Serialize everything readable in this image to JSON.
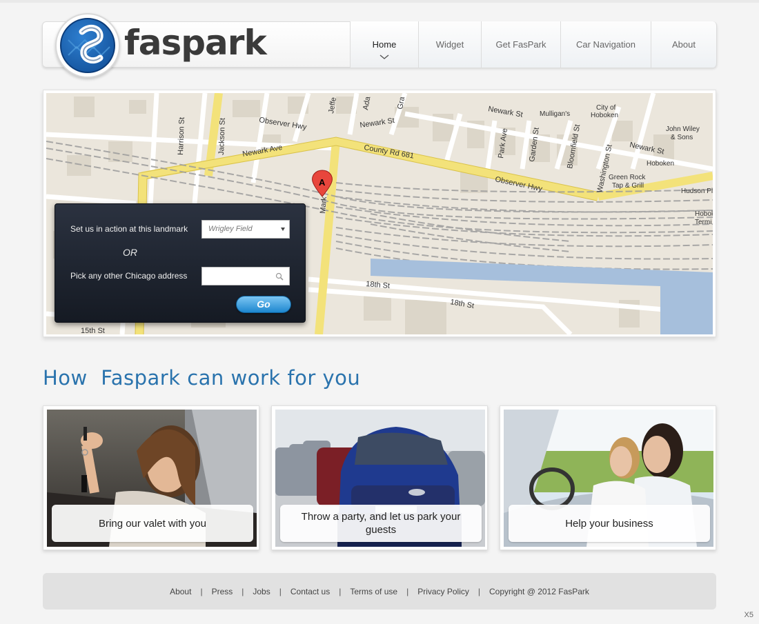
{
  "brand": {
    "name": "faspark"
  },
  "nav": {
    "items": [
      {
        "label": "Home",
        "active": true
      },
      {
        "label": "Widget"
      },
      {
        "label": "Get FasPark"
      },
      {
        "label": "Car Navigation"
      },
      {
        "label": "About"
      }
    ]
  },
  "map": {
    "marker_label": "A",
    "streets": [
      "Harrison St",
      "Jackson St",
      "Observer Hwy",
      "Newark Ave",
      "County Rd 681",
      "Newark St",
      "Mulligan's",
      "City of Hoboken",
      "John Wiley & Sons",
      "Park Ave",
      "Garden St",
      "Bloomfield St",
      "Washington St",
      "Hoboken",
      "Green Rock Tap & Grill",
      "Observer Hwy",
      "Hudson Pl",
      "18th St",
      "18th St",
      "15th St",
      "Hobok Termi",
      "Jeffe",
      "Ada",
      "Gra",
      "Newark St",
      "Mark"
    ]
  },
  "finder": {
    "landmark_label": "Set us in action at this landmark",
    "landmark_value": "Wrigley Field",
    "or_label": "OR",
    "address_label": "Pick any other Chicago address",
    "address_value": "",
    "go_label": "Go"
  },
  "section": {
    "title": "How  Faspark can work for you",
    "cards": [
      {
        "caption": "Bring our valet with you"
      },
      {
        "caption": "Throw a party, and let us park your guests"
      },
      {
        "caption": "Help your business"
      }
    ]
  },
  "footer": {
    "links": [
      "About",
      "Press",
      "Jobs",
      "Contact us",
      "Terms of use",
      "Privacy Policy"
    ],
    "copyright": "Copyright @ 2012 FasPark"
  },
  "corner_badge": "X5",
  "colors": {
    "accent": "#2a73ad",
    "button": "#1d86cf",
    "panel": "#1e2430"
  }
}
